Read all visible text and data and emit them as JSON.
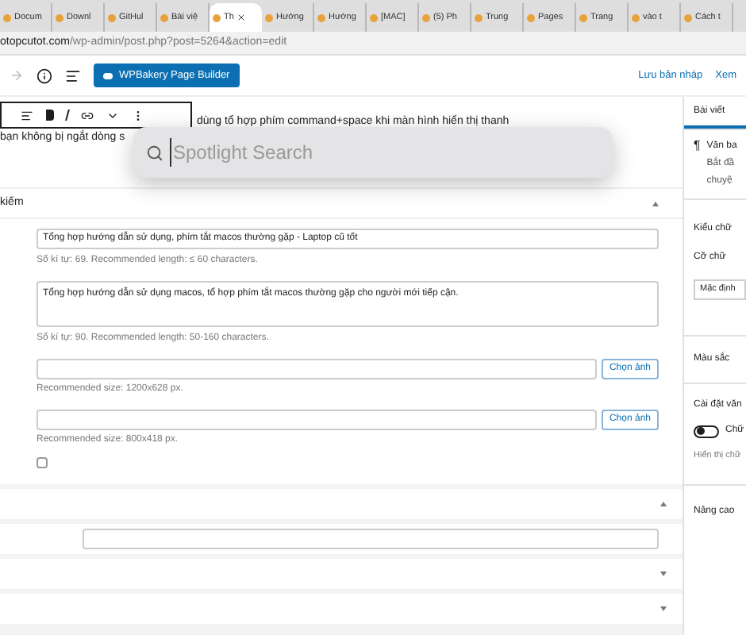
{
  "browser": {
    "tabs": [
      {
        "label": "Docum",
        "selected": false
      },
      {
        "label": "Downl",
        "selected": false
      },
      {
        "label": "GitHul",
        "selected": false
      },
      {
        "label": "Bài việ",
        "selected": false
      },
      {
        "label": "Th",
        "selected": true
      },
      {
        "label": "Hướng",
        "selected": false
      },
      {
        "label": "Hướng",
        "selected": false
      },
      {
        "label": "[MAC]",
        "selected": false
      },
      {
        "label": "(5) Ph",
        "selected": false
      },
      {
        "label": "Trung",
        "selected": false
      },
      {
        "label": "Pages",
        "selected": false
      },
      {
        "label": "Trang",
        "selected": false
      },
      {
        "label": "vào t",
        "selected": false
      },
      {
        "label": "Cách t",
        "selected": false
      }
    ],
    "url": {
      "host": "otopcutot.com",
      "path": "/wp-admin/post.php?post=5264&action=edit"
    }
  },
  "editor_header": {
    "builder_button": "WPBakery Page Builder",
    "save_draft": "Lưu bản nháp",
    "preview": "Xem"
  },
  "content": {
    "line_1_right": "dùng tổ hợp phím command+space khi màn hình hiển thị thanh",
    "line_2": "bạn không bị ngắt dòng s"
  },
  "spotlight": {
    "placeholder": "Spotlight Search"
  },
  "seo_panel": {
    "title": "kiếm",
    "expanded": true,
    "seo_title": {
      "value": "Tổng hợp hướng dẫn sử dụng, phím tắt macos thường gặp - Laptop cũ tốt",
      "hint": "Số kí tự: 69. Recommended length: ≤ 60 characters."
    },
    "description": {
      "value": "Tổng hợp hướng dẫn sử dụng macos, tổ hợp phím tắt macos thường gặp cho người mới tiếp cận.",
      "hint": "Số kí tự: 90. Recommended length: 50-160 characters."
    },
    "images": [
      {
        "button": "Chọn ảnh",
        "hint": "Recommended size: 1200x628 px."
      },
      {
        "button": "Chọn ảnh",
        "hint": "Recommended size: 800x418 px."
      }
    ],
    "checkbox": {
      "checked": false
    }
  },
  "panels": [
    {
      "expanded": true
    },
    {
      "expanded": false
    },
    {
      "expanded": false
    }
  ],
  "sidebar": {
    "tabs": [
      {
        "label": "Bài viết",
        "selected": true
      }
    ],
    "block": {
      "icon": "¶",
      "name": "Văn ba",
      "description_1": "Bắt đầ",
      "description_2": "chuyệ"
    },
    "typography": {
      "title": "Kiểu chữ",
      "size_label": "Cỡ chữ",
      "size_value": "Mặc định"
    },
    "color_title": "Màu sắc",
    "text_settings": {
      "title": "Cài đặt văn",
      "toggle_label": "Chữ",
      "toggle_on": false,
      "help": "Hiển thị chữ"
    },
    "advanced": "Nâng cao"
  }
}
